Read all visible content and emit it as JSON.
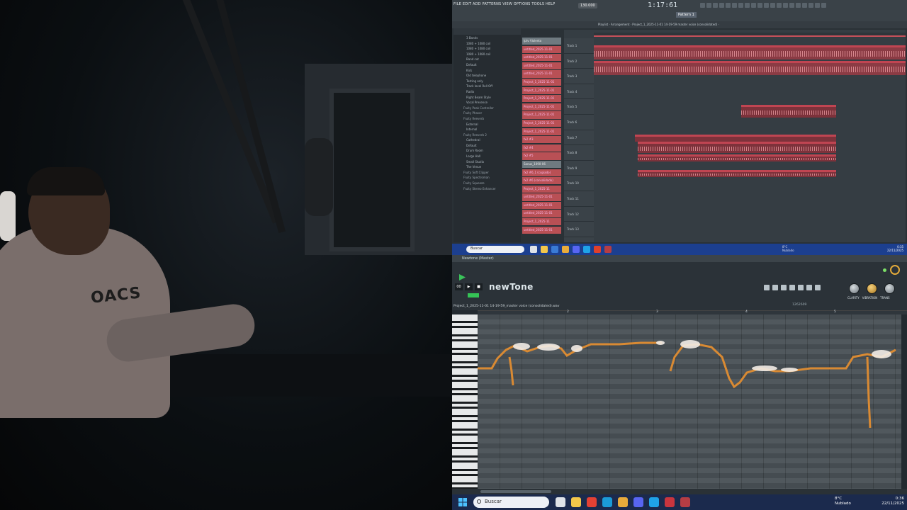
{
  "fl": {
    "menu": "FILE EDIT ADD PATTERNS VIEW OPTIONS TOOLS HELP",
    "clock": "1:17:61",
    "tempo": "130.000",
    "pattern": "Pattern 1",
    "playlist_title": "Playlist · Arrangement · Project_1_2025-11-01 14-19-59 master voice (consolidated) ·",
    "browser_items": [
      {
        "label": "3 Bands",
        "style": "sub"
      },
      {
        "label": "1080 + 1080 coil",
        "style": "sub"
      },
      {
        "label": "1080 + 1080 coil",
        "style": "sub"
      },
      {
        "label": "1080 + 1080 coil",
        "style": "sub"
      },
      {
        "label": "Band cut",
        "style": "sub"
      },
      {
        "label": "Default",
        "style": "sub"
      },
      {
        "label": "Kick",
        "style": "sub"
      },
      {
        "label": "Old telephone",
        "style": "sub"
      },
      {
        "label": "Testing only",
        "style": "sub"
      },
      {
        "label": "Track level Roll Off",
        "style": "sub"
      },
      {
        "label": "Radio",
        "style": "sub"
      },
      {
        "label": "Right Beam Style",
        "style": "sub"
      },
      {
        "label": "Vocal Presence",
        "style": "sub"
      },
      {
        "label": "Fruity Peak Controller",
        "style": "fold"
      },
      {
        "label": "Fruity Phaser",
        "style": "fold"
      },
      {
        "label": "Fruity Reeverb",
        "style": "fold"
      },
      {
        "label": "External",
        "style": "sub"
      },
      {
        "label": "Internal",
        "style": "sub"
      },
      {
        "label": "Fruity Reeverb 2",
        "style": "fold"
      },
      {
        "label": "Cathedral",
        "style": "sub"
      },
      {
        "label": "Default",
        "style": "sub"
      },
      {
        "label": "Drum Room",
        "style": "sub"
      },
      {
        "label": "Large Hall",
        "style": "sub"
      },
      {
        "label": "Small Studio",
        "style": "sub"
      },
      {
        "label": "The Venue",
        "style": "sub"
      },
      {
        "label": "Fruity Soft Clipper",
        "style": "fold"
      },
      {
        "label": "Fruity Spectroman",
        "style": "fold"
      },
      {
        "label": "Fruity Squeeze",
        "style": "fold"
      },
      {
        "label": "Fruity Stereo Enhancer",
        "style": "fold"
      }
    ],
    "track_buttons": [
      {
        "label": "Iptv Violento",
        "gray": true
      },
      {
        "label": "untitled_2025-11-01",
        "gray": false
      },
      {
        "label": "untitled_2025-11-01",
        "gray": false
      },
      {
        "label": "untitled_2025-11-01",
        "gray": false
      },
      {
        "label": "untitled_2025-11-01",
        "gray": false
      },
      {
        "label": "Project_1_2025-11-01",
        "gray": false
      },
      {
        "label": "Project_1_2025-11-01",
        "gray": false
      },
      {
        "label": "Project_1_2025-11-01",
        "gray": false
      },
      {
        "label": "Project_1_2025-11-01",
        "gray": false
      },
      {
        "label": "Project_1_2025-11-01",
        "gray": false
      },
      {
        "label": "Project_1_2025-11-01",
        "gray": false
      },
      {
        "label": "Project_1_2025-11-01",
        "gray": false
      },
      {
        "label": "fx2 #3",
        "gray": false
      },
      {
        "label": "fx2 #4",
        "gray": false
      },
      {
        "label": "fx2 #5",
        "gray": false
      },
      {
        "label": "Sanus_1090-06",
        "gray": true
      },
      {
        "label": "fx2 #6_1 (copiado)",
        "gray": false
      },
      {
        "label": "fx2 #6 (consolidado)",
        "gray": false
      },
      {
        "label": "Project_1_2025-11",
        "gray": false
      },
      {
        "label": "untitled_2025-11-01",
        "gray": false
      },
      {
        "label": "untitled_2025-11-01",
        "gray": false
      },
      {
        "label": "untitled_2025-11-01",
        "gray": false
      },
      {
        "label": "Project_1_2025-11",
        "gray": false
      },
      {
        "label": "untitled_2025-11-01",
        "gray": false
      }
    ],
    "track_headers": [
      "Track 1",
      "Track 2",
      "Track 3",
      "Track 4",
      "Track 5",
      "Track 6",
      "Track 7",
      "Track 8",
      "Track 9",
      "Track 10",
      "Track 11",
      "Track 12",
      "Track 13"
    ]
  },
  "taskbar_top": {
    "search": "Buscar",
    "weather_temp": "8°C",
    "weather_desc": "Nublado",
    "time": "0:35",
    "date": "22/11/2025"
  },
  "newtone": {
    "window_title": "Newtone (Master)",
    "logo": "newTone",
    "file": "Project_1_2025-11-01 14-19-59_master voice (consolidated).wav",
    "ruler": [
      "2",
      "3",
      "4",
      "5"
    ],
    "transport": [
      "00",
      "▶",
      "■",
      "●"
    ],
    "knobs": [
      "CLARITY",
      "VIBRATION",
      "TRANS"
    ],
    "position": "1262609"
  },
  "taskbar": {
    "search": "Buscar",
    "weather_temp": "8°C",
    "weather_desc": "Nublado",
    "time": "0:36",
    "date": "22/11/2025"
  },
  "camera": {
    "hoodie_text": "OACS"
  },
  "colors": {
    "clip": "#c04552",
    "pitch_line": "#d98a33",
    "taskbar": "#1b2a4d",
    "accent_green": "#3ac35a"
  }
}
